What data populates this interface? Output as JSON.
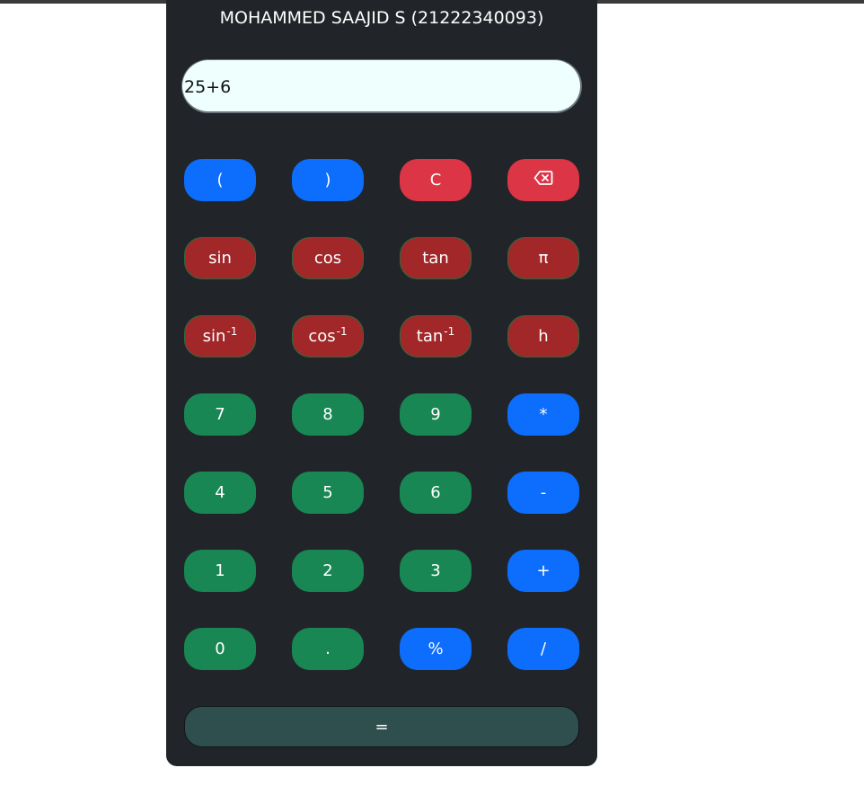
{
  "title": "MOHAMMED SAAJID S (21222340093)",
  "display": {
    "value": "25+6"
  },
  "colors": {
    "operator": "#0d6efd",
    "clear": "#dc3545",
    "scientific": "#a12729",
    "digit": "#198754",
    "equals": "#2f4f4f",
    "panel": "#212529",
    "display_bg": "#eefffd"
  },
  "keys": {
    "open_paren": "(",
    "close_paren": ")",
    "clear": "C",
    "backspace_icon": "backspace-icon",
    "sin": "sin",
    "cos": "cos",
    "tan": "tan",
    "pi": "π",
    "asin_base": "sin",
    "acos_base": "cos",
    "atan_base": "tan",
    "inverse_exp": "-1",
    "h": "h",
    "seven": "7",
    "eight": "8",
    "nine": "9",
    "multiply": "*",
    "four": "4",
    "five": "5",
    "six": "6",
    "minus": "-",
    "one": "1",
    "two": "2",
    "three": "3",
    "plus": "+",
    "zero": "0",
    "dot": ".",
    "percent": "%",
    "divide": "/",
    "equals": "="
  }
}
